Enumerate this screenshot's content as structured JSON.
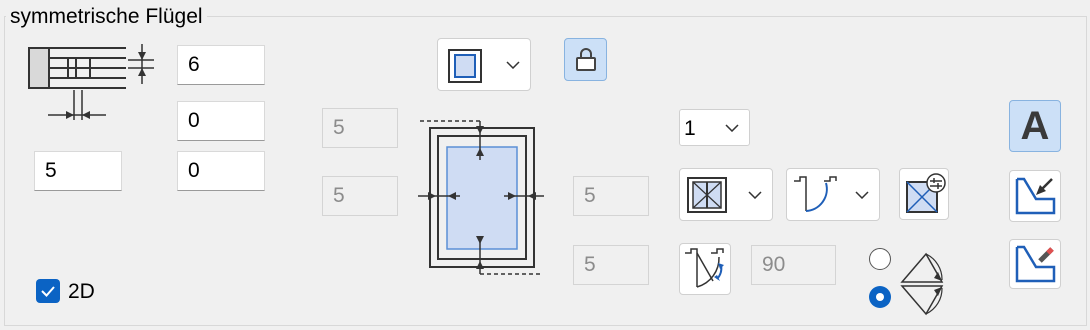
{
  "group": {
    "title": "symmetrische Flügel"
  },
  "left_fields": {
    "top": "6",
    "middle": "0",
    "left": "5",
    "right": "0"
  },
  "center_fields": {
    "top_left": "5",
    "mid_left": "5",
    "mid_right": "5",
    "bottom_right": "5"
  },
  "dropdowns": {
    "count_value": "1"
  },
  "angle_field": {
    "value": "90"
  },
  "checkbox_2d": {
    "label": "2D",
    "checked": true
  },
  "text_button": {
    "label": "A"
  },
  "radio_options": {
    "selected": "lower"
  },
  "colors": {
    "accent": "#0b63c4",
    "active_bg": "#cce0f7",
    "pane_fill": "#cfdcf3"
  }
}
